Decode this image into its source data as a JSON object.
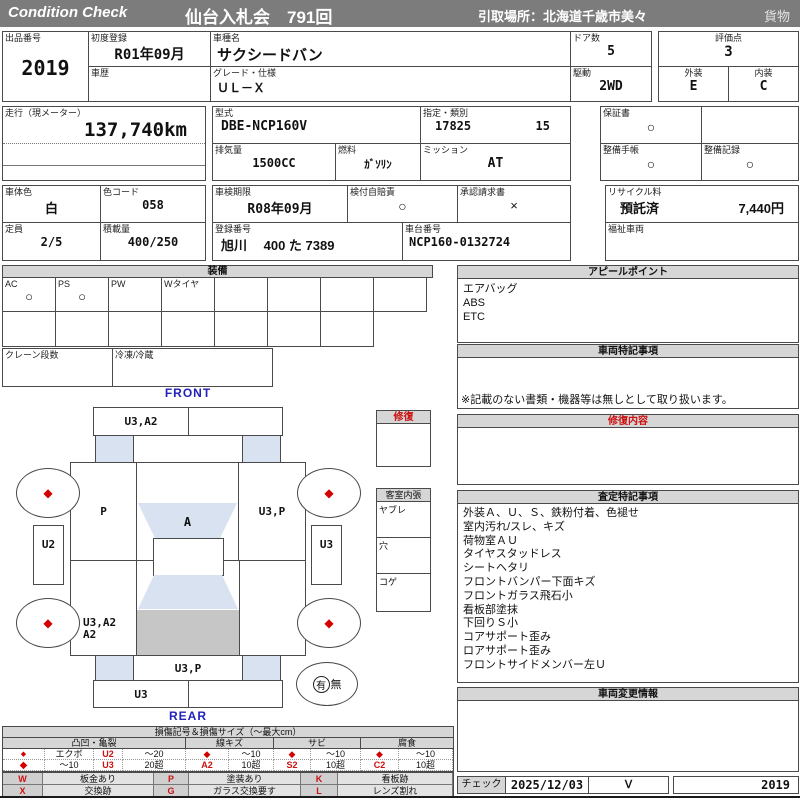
{
  "header": {
    "logo": "Condition Check",
    "auction": "仙台入札会　791回",
    "pickup": "引取場所：北海道千歳市美々",
    "category": "貨物"
  },
  "vehicle": {
    "lot_label": "出品番号",
    "lot": "2019",
    "first_reg_label": "初度登録",
    "first_reg": "R01年09月",
    "history_label": "車歴",
    "model_label": "車種名",
    "model": "サクシードバン",
    "grade_label": "グレード・仕様",
    "grade": "ＵＬ－Ｘ",
    "doors_label": "ドア数",
    "doors": "5",
    "drive_label": "駆動",
    "drive": "2WD",
    "score_label": "評価点",
    "score": "3",
    "ext_label": "外装",
    "ext": "E",
    "int_label": "内装",
    "int": "C",
    "mileage_label": "走行（現メーター）",
    "mileage": "137,740km",
    "model_code_label": "型式",
    "model_code": "DBE-NCP160V",
    "class_label": "指定・類別",
    "class_no": "17825",
    "class_sub": "15",
    "disp_label": "排気量",
    "disp": "1500CC",
    "fuel_label": "燃料",
    "fuel": "ｶﾞｿﾘﾝ",
    "mission_label": "ミッション",
    "mission": "AT",
    "warranty_label": "保証書",
    "warranty": "○",
    "book_label": "整備手帳",
    "book": "○",
    "record_label": "整備記録",
    "record": "○",
    "body_color_label": "車体色",
    "body_color": "白",
    "color_code_label": "色コード",
    "color_code": "058",
    "capacity_label": "定員",
    "capacity": "2/5",
    "load_label": "積載量",
    "load": "400/250",
    "inspection_label": "車検期限",
    "inspection": "R08年09月",
    "jibaiseki_label": "検付自賠責",
    "jibaiseki": "○",
    "approval_label": "承認請求書",
    "approval": "×",
    "reg_no_label": "登録番号",
    "reg_no": "旭川　 400 た  7389",
    "chassis_label": "車台番号",
    "chassis": "NCP160-0132724",
    "recycle_label": "リサイクル料",
    "recycle_status": "預託済",
    "recycle_fee": "7,440円",
    "welfare_label": "福祉車両"
  },
  "equipment": {
    "title": "装備",
    "cells": [
      {
        "label": "AC",
        "mark": "○"
      },
      {
        "label": "PS",
        "mark": "○"
      },
      {
        "label": "PW",
        "mark": ""
      },
      {
        "label": "Wタイヤ",
        "mark": ""
      }
    ],
    "crane_label": "クレーン段数",
    "freezer_label": "冷凍/冷蔵"
  },
  "diagram": {
    "front": "FRONT",
    "rear": "REAR",
    "front_bumper": "U3,A2",
    "left_fender": "P",
    "hood": "A",
    "right_fender": "U3,P",
    "left_door": "U2",
    "right_door": "U3",
    "quarter_line1": "U3,A2",
    "quarter_line2": "A2",
    "tailgate": "U3,P",
    "rear_bumper": "U3",
    "wheel_mark": "◆",
    "spare_yes": "有",
    "spare_no": "無"
  },
  "repair_box": {
    "title": "修復"
  },
  "cabin_box": {
    "title": "客室内張",
    "row1": "ヤブレ",
    "row2": "穴",
    "row3": "コゲ"
  },
  "panels": {
    "appeal": {
      "title": "アピールポイント",
      "items": [
        "エアバッグ",
        "ABS",
        "ETC"
      ]
    },
    "notes": {
      "title": "車両特記事項",
      "disclaimer": "※記載のない書類・機器等は無しとして取り扱います。"
    },
    "repair_detail": {
      "title": "修復内容"
    },
    "assessment": {
      "title": "査定特記事項",
      "items": [
        "外装Ａ、Ｕ、Ｓ、鉄粉付着、色褪せ",
        "室内汚れ/スレ、キズ",
        "荷物室ＡＵ",
        "タイヤスタッドレス",
        "シートヘタリ",
        "フロントバンパー下面キズ",
        "フロントガラス飛石小",
        "看板部塗抹",
        "下回りＳ小",
        "コアサポート歪み",
        "ロアサポート歪み",
        "フロントサイドメンバー左Ｕ"
      ]
    },
    "change": {
      "title": "車両変更情報"
    }
  },
  "check": {
    "label": "チェック",
    "date": "2025/12/03",
    "mark": "Ｖ",
    "lot": "2019"
  },
  "legend": {
    "title": "損傷記号＆損傷サイズ（～最大cm）",
    "groups": [
      "凸凹・亀裂",
      "線キズ",
      "サビ",
      "腐食"
    ],
    "row1": [
      "◆",
      "エクボ",
      "U2",
      "～20",
      "◆",
      "～10",
      "◆",
      "～10",
      "◆",
      "～10"
    ],
    "row2": [
      "◆",
      "～10",
      "U3",
      "20超",
      "A2",
      "10超",
      "S2",
      "10超",
      "C2",
      "10超"
    ],
    "codes": [
      {
        "code": "W",
        "desc": "板金あり"
      },
      {
        "code": "P",
        "desc": "塗装あり"
      },
      {
        "code": "K",
        "desc": "看板跡"
      },
      {
        "code": "X",
        "desc": "交換跡"
      },
      {
        "code": "G",
        "desc": "ガラス交換要す"
      },
      {
        "code": "L",
        "desc": "レンズ割れ"
      }
    ]
  },
  "colors": {
    "header_bg": "#7c7c7c",
    "section_bg": "#d6d6d6",
    "accent_red": "#cc1111",
    "label_blue": "#2222bb",
    "glass_blue": "#d9e2f0",
    "roof_gray": "#c6c6c6"
  }
}
